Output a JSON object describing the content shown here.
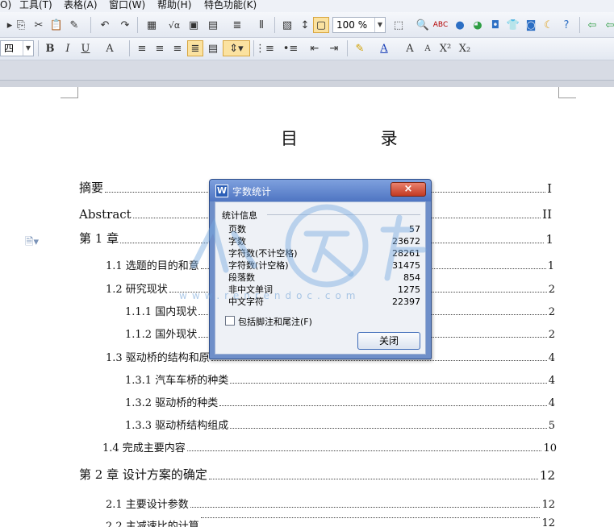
{
  "menu": {
    "items": [
      "O)",
      "工具(T)",
      "表格(A)",
      "窗口(W)",
      "帮助(H)",
      "特色功能(K)"
    ]
  },
  "toolbar": {
    "zoom": "100 %",
    "font_size": "四"
  },
  "document": {
    "toc_title": "目    录",
    "entries": [
      {
        "label": "摘要",
        "page": "I"
      },
      {
        "label": "Abstract",
        "page": "II"
      },
      {
        "label": "第 1 章",
        "page": "1"
      },
      {
        "label": "1.1  选题的目的和意",
        "page": "1"
      },
      {
        "label": "1.2  研究现状",
        "page": "2"
      },
      {
        "label": "1.1.1  国内现状",
        "page": "2"
      },
      {
        "label": "1.1.2  国外现状",
        "page": "2"
      },
      {
        "label": "1.3  驱动桥的结构和原",
        "page": "4"
      },
      {
        "label": "1.3.1  汽车车桥的种类",
        "page": "4"
      },
      {
        "label": "1.3.2  驱动桥的种类",
        "page": "4"
      },
      {
        "label": "1.3.3  驱动桥结构组成",
        "page": "5"
      },
      {
        "label": "1.4  完成主要内容",
        "page": "10"
      },
      {
        "label": "第 2 章  设计方案的确定",
        "page": "12"
      },
      {
        "label": "2.1  主要设计参数",
        "page": "12"
      },
      {
        "label": "2.2  主减速比的计算",
        "page": "12"
      }
    ]
  },
  "dialog": {
    "title": "字数统计",
    "close_x": "×",
    "group": "统计信息",
    "stats": [
      {
        "label": "页数",
        "value": "57"
      },
      {
        "label": "字数",
        "value": "23672"
      },
      {
        "label": "字符数(不计空格)",
        "value": "28261"
      },
      {
        "label": "字符数(计空格)",
        "value": "31475"
      },
      {
        "label": "段落数",
        "value": "854"
      },
      {
        "label": "非中文单词",
        "value": "1275"
      },
      {
        "label": "中文字符",
        "value": "22397"
      }
    ],
    "checkbox_label": "包括脚注和尾注(F)",
    "checkbox_checked": false,
    "close_button": "关闭"
  },
  "watermark": {
    "text": "www.renrendoc.com"
  },
  "colors": {
    "dialog_frame": "#6f8fc9",
    "close_red": "#c23a22",
    "accent": "#3d6bb8"
  }
}
